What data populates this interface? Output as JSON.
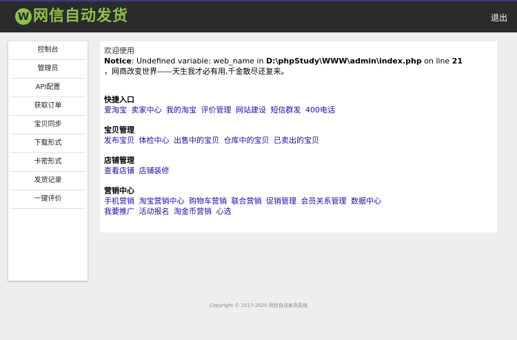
{
  "header": {
    "logo_badge": "W",
    "logo_text": "网信自动发货",
    "logout_label": "退出",
    "accent_color": "#8bc34a"
  },
  "sidebar": {
    "items": [
      {
        "label": "控制台"
      },
      {
        "label": "管理员"
      },
      {
        "label": "API配置"
      },
      {
        "label": "获取订单"
      },
      {
        "label": "宝贝同步"
      },
      {
        "label": "下载形式"
      },
      {
        "label": "卡密形式"
      },
      {
        "label": "发货记录"
      },
      {
        "label": "一键评价"
      }
    ]
  },
  "main": {
    "welcome": "欢迎使用",
    "notice": {
      "label": "Notice",
      "text1": ": Undefined variable: web_name in ",
      "path": "D:\\phpStudy\\WWW\\admin\\index.php",
      "text2": " on line ",
      "line": "21"
    },
    "slogan": "，网商改变世界——天生我才必有用,千金散尽还复来。",
    "sections": [
      {
        "title": "快捷入口",
        "links": [
          "爱淘宝",
          "卖家中心",
          "我的淘宝",
          "评价管理",
          "网站建设",
          "短信群发",
          "400电话"
        ]
      },
      {
        "title": "宝贝管理",
        "links": [
          "发布宝贝",
          "体检中心",
          "出售中的宝贝",
          "仓库中的宝贝",
          "已卖出的宝贝"
        ]
      },
      {
        "title": "店铺管理",
        "links": [
          "查看店铺",
          "店铺装修"
        ]
      },
      {
        "title": "营销中心",
        "links": [
          "手机营销",
          "淘宝营销中心",
          "购物车营销",
          "联合营销",
          "促销管理",
          "会员关系管理",
          "数据中心"
        ],
        "links2": [
          "我要推广",
          "活动报名",
          "淘金币营销",
          "心选"
        ]
      }
    ]
  },
  "footer": {
    "copyright": "Copyright © 2017-2020 网信自动发货系统"
  }
}
